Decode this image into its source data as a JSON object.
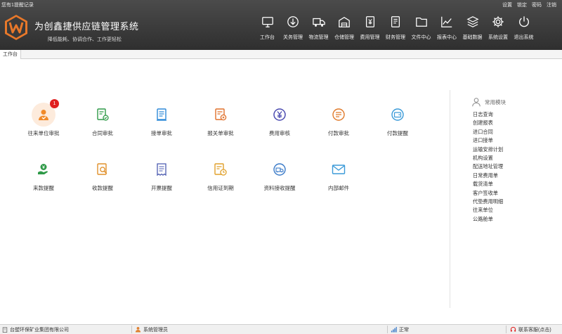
{
  "header": {
    "remind_link": "您有1提醒记录",
    "top_links": [
      "设置",
      "锁定",
      "密码",
      "注销"
    ],
    "title": "为创鑫捷供应链管理系统",
    "slogan": "降低能耗、协调合作、工作更轻松",
    "nav": [
      {
        "label": "工作台",
        "icon": "monitor-icon"
      },
      {
        "label": "关务管理",
        "icon": "download-circle-icon"
      },
      {
        "label": "物流管理",
        "icon": "truck-icon"
      },
      {
        "label": "仓储管理",
        "icon": "warehouse-icon"
      },
      {
        "label": "费用管理",
        "icon": "yen-document-icon"
      },
      {
        "label": "财务管理",
        "icon": "finance-document-icon"
      },
      {
        "label": "文件中心",
        "icon": "folder-icon"
      },
      {
        "label": "报表中心",
        "icon": "line-chart-icon"
      },
      {
        "label": "基础数据",
        "icon": "layers-icon"
      },
      {
        "label": "系统设置",
        "icon": "gear-icon"
      },
      {
        "label": "退出系统",
        "icon": "power-icon"
      }
    ]
  },
  "tabs": [
    {
      "label": "工作台"
    }
  ],
  "modules": [
    {
      "label": "往来单位审批",
      "icon": "person-approve-icon",
      "badge": "1",
      "color": "#f08a2a"
    },
    {
      "label": "合同审批",
      "icon": "contract-approve-icon",
      "color": "#2f9a48"
    },
    {
      "label": "接单审批",
      "icon": "order-document-icon",
      "color": "#2e8ad8"
    },
    {
      "label": "报关单审批",
      "icon": "customs-document-icon",
      "color": "#e0702a"
    },
    {
      "label": "费用审核",
      "icon": "yen-circle-icon",
      "color": "#4b4bb0"
    },
    {
      "label": "付款审批",
      "icon": "payment-list-icon",
      "color": "#e07a2a"
    },
    {
      "label": "付款提醒",
      "icon": "wallet-icon",
      "color": "#3a9ad8"
    },
    {
      "label": "来款提醒",
      "icon": "money-hand-icon",
      "color": "#2f9a48"
    },
    {
      "label": "收款提醒",
      "icon": "receipt-search-icon",
      "color": "#e0902a"
    },
    {
      "label": "开票提醒",
      "icon": "invoice-icon",
      "color": "#4b5bb0"
    },
    {
      "label": "信用证到期",
      "icon": "credit-clock-icon",
      "color": "#e0a02a"
    },
    {
      "label": "资料接收提醒",
      "icon": "data-receive-icon",
      "color": "#3a7ac8"
    },
    {
      "label": "内部邮件",
      "icon": "mail-icon",
      "color": "#3a9ad8"
    }
  ],
  "side": {
    "title": "常用模块",
    "items": [
      "日志查询",
      "创建报表",
      "进口合同",
      "进口接单",
      "运输安排计划",
      "机构设置",
      "配送地址管理",
      "日常费用单",
      "载货清单",
      "客户签收单",
      "代垫费用明细",
      "往来单位",
      "公路舱单"
    ]
  },
  "status": {
    "company": "台塑环保矿业集团有限公司",
    "user": "系统管理员",
    "state": "正常",
    "support": "联系客服(点击)"
  },
  "colors": {
    "header_bg": "#3a3a3a",
    "logo": "#e8782a",
    "badge": "#e02020"
  }
}
